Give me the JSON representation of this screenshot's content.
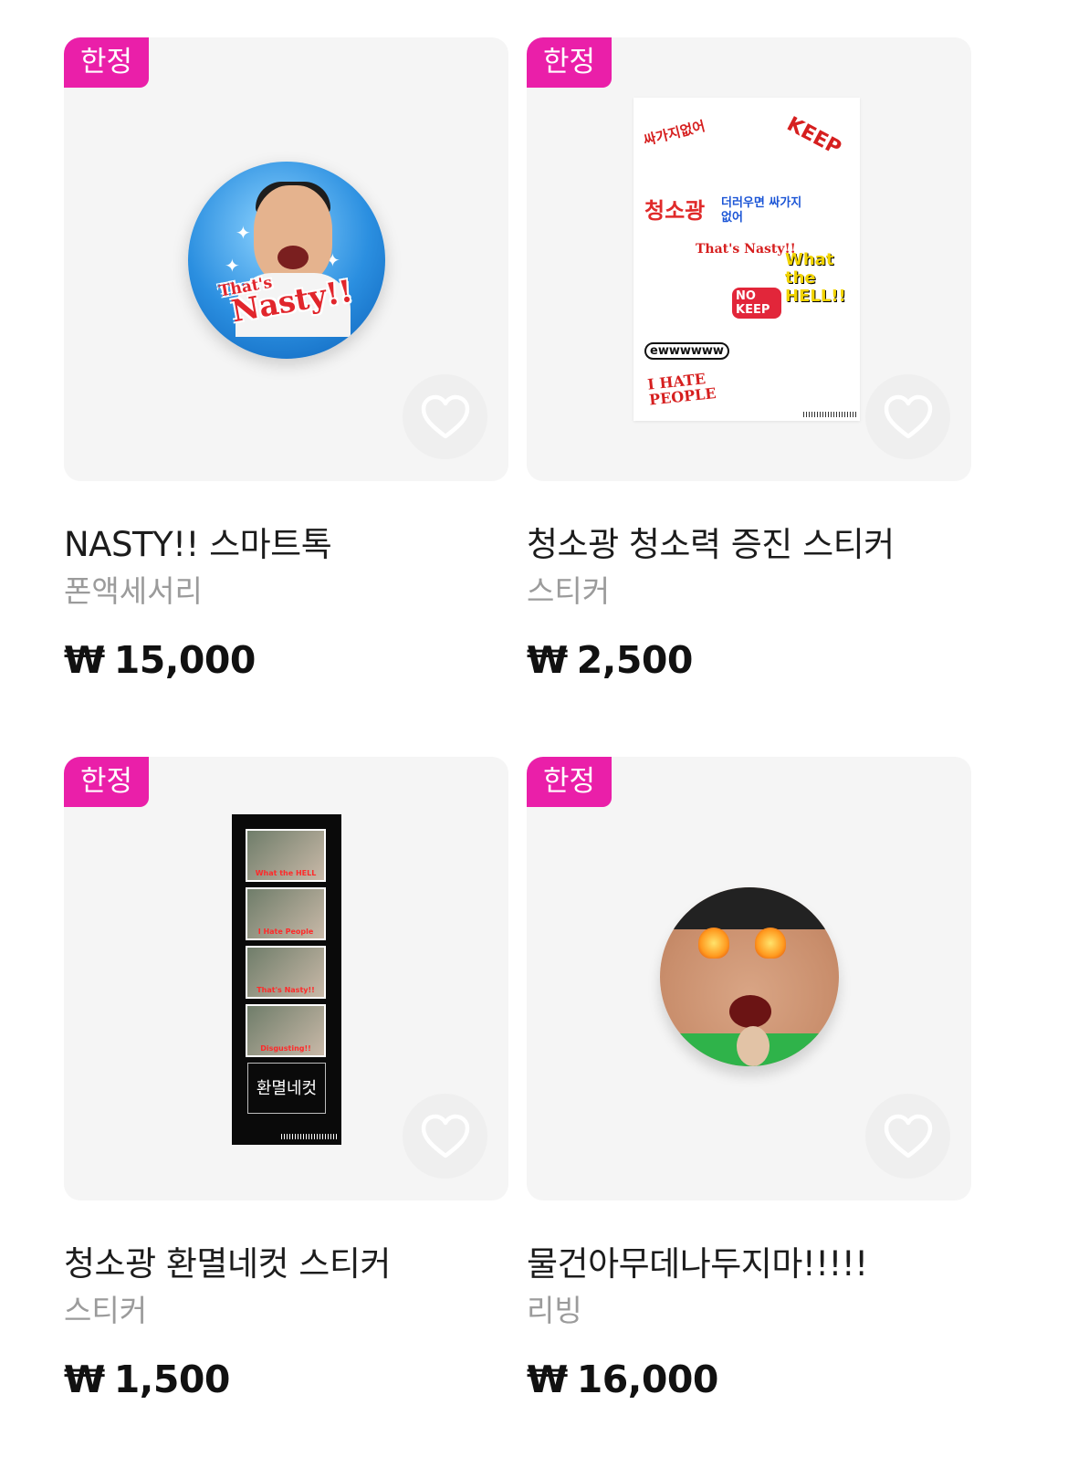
{
  "products": [
    {
      "badge": "한정",
      "title": "NASTY!! 스마트톡",
      "category": "폰액세서리",
      "currency": "₩",
      "price": "15,000",
      "art_text": [
        "That's",
        "Nasty!!"
      ],
      "favorited": false
    },
    {
      "badge": "한정",
      "title": "청소광 청소력 증진 스티커",
      "category": "스티커",
      "currency": "₩",
      "price": "2,500",
      "art_text": [
        "싸가지없어",
        "KEEP",
        "청소광",
        "더러우면 싸가지 없어",
        "That's Nasty!!",
        "What the HELL!!",
        "NO KEEP",
        "ewwwwww",
        "I HATE PEOPLE"
      ],
      "favorited": false
    },
    {
      "badge": "한정",
      "title": "청소광 환멸네컷 스티커",
      "category": "스티커",
      "currency": "₩",
      "price": "1,500",
      "art_text": [
        "What the HELL",
        "I Hate People",
        "That's Nasty!!",
        "Disgusting!!",
        "환멸네컷"
      ],
      "favorited": false
    },
    {
      "badge": "한정",
      "title": "물건아무데나두지마!!!!!",
      "category": "리빙",
      "currency": "₩",
      "price": "16,000",
      "art_text": [],
      "favorited": false
    }
  ],
  "icons": {
    "favorite": "heart-outline-icon"
  },
  "colors": {
    "badge_bg": "#ea1fa9",
    "thumb_bg": "#f5f5f5",
    "category_text": "#9b9b9b"
  }
}
